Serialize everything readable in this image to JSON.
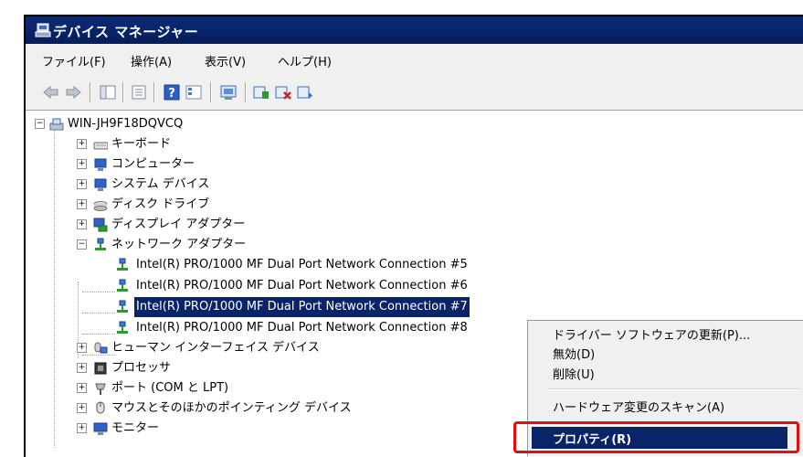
{
  "window": {
    "title": "デバイス マネージャー"
  },
  "menu": [
    "ファイル(F)",
    "操作(A)",
    "表示(V)",
    "ヘルプ(H)"
  ],
  "toolbar": {
    "buttons": [
      "back-icon",
      "forward-icon",
      "show-hide-tree-icon",
      "properties-icon",
      "help-icon",
      "view-icon",
      "scan-hardware-icon",
      "update-driver-icon",
      "uninstall-icon",
      "disable-icon"
    ]
  },
  "tree": {
    "root": "WIN-JH9F18DQVCQ",
    "categories": [
      {
        "label": "キーボード",
        "icon": "keyboard-icon"
      },
      {
        "label": "コンピューター",
        "icon": "computer-icon"
      },
      {
        "label": "システム デバイス",
        "icon": "system-device-icon"
      },
      {
        "label": "ディスク ドライブ",
        "icon": "disk-drive-icon"
      },
      {
        "label": "ディスプレイ アダプター",
        "icon": "display-adapter-icon"
      },
      {
        "label": "ネットワーク アダプター",
        "icon": "network-adapter-icon"
      }
    ],
    "network_children": [
      "Intel(R) PRO/1000 MF Dual Port Network Connection #5",
      "Intel(R) PRO/1000 MF Dual Port Network Connection #6",
      "Intel(R) PRO/1000 MF Dual Port Network Connection #7",
      "Intel(R) PRO/1000 MF Dual Port Network Connection #8"
    ],
    "selected_index": 2,
    "more_categories": [
      {
        "label": "ヒューマン インターフェイス デバイス",
        "icon": "hid-icon"
      },
      {
        "label": "プロセッサ",
        "icon": "processor-icon"
      },
      {
        "label": "ポート (COM と LPT)",
        "icon": "port-icon"
      },
      {
        "label": "マウスとそのほかのポインティング デバイス",
        "icon": "mouse-icon"
      },
      {
        "label": "モニター",
        "icon": "monitor-icon"
      }
    ]
  },
  "context_menu": {
    "items": [
      "ドライバー ソフトウェアの更新(P)...",
      "無効(D)",
      "削除(U)",
      "ハードウェア変更のスキャン(A)",
      "プロパティ(R)"
    ],
    "highlighted": "プロパティ(R)"
  },
  "colors": {
    "title_bar": "#0a246a",
    "selection": "#0a246a",
    "highlight_box": "#e01010"
  }
}
